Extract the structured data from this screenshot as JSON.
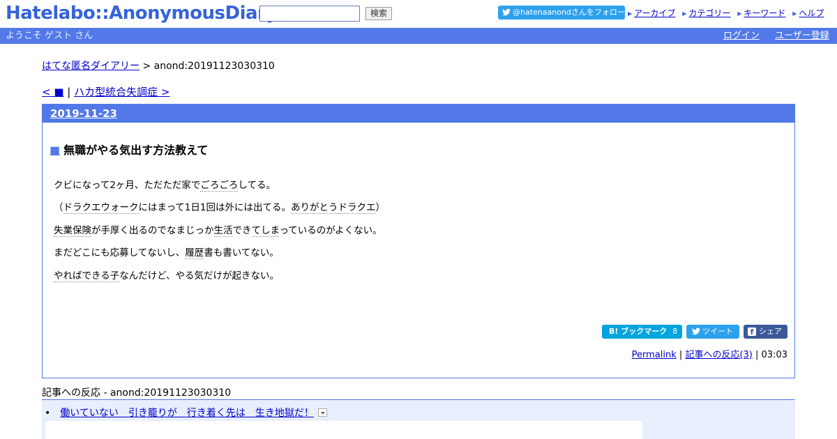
{
  "header": {
    "logo": "Hatelabo::AnonymousDiary",
    "search_value": "",
    "search_button": "検索",
    "follow_button": "@hatenaanondさんをフォロー",
    "links": [
      "アーカイブ",
      "カテゴリー",
      "キーワード",
      "ヘルプ"
    ]
  },
  "bar": {
    "welcome": "ようこそ ゲスト さん",
    "login": "ログイン",
    "signup": "ユーザー登録"
  },
  "breadcrumb": {
    "home": "はてな匿名ダイアリー",
    "separator": " > ",
    "current": "anond:20191123030310"
  },
  "nav": {
    "prev": "< ■",
    "separator": " | ",
    "next": "ハカ型統合失調症 >"
  },
  "day": {
    "date": "2019-11-23",
    "entry": {
      "marker": "■",
      "title": "無職がやる気出す方法教えて",
      "paragraphs": [
        "クビになって2ヶ月、ただただ家でごろごろしてる。",
        "（ドラクエウォークにはまって1日1回は外には出てる。ありがとうドラクエ）",
        "失業保険が手厚く出るのでなまじっか生活できてしまっているのがよくない。",
        "まだどこにも応募してないし、履歴書も書いてない。",
        "やればできる子なんだけど、やる気だけが起きない。"
      ]
    },
    "share": {
      "hatebu": "B! ブックマーク",
      "hatebu_count": "8",
      "tweet": "ツイート",
      "facebook": "シェア"
    },
    "footer": {
      "permalink": "Permalink",
      "separator1": " | ",
      "reactions": "記事への反応(3)",
      "separator2": " | ",
      "time": "03:03"
    }
  },
  "refer": {
    "heading": "記事への反応 - anond:20191123030310",
    "items": [
      "働いていない　引き籠りが　行き着く先は　生き地獄だ！"
    ]
  }
}
